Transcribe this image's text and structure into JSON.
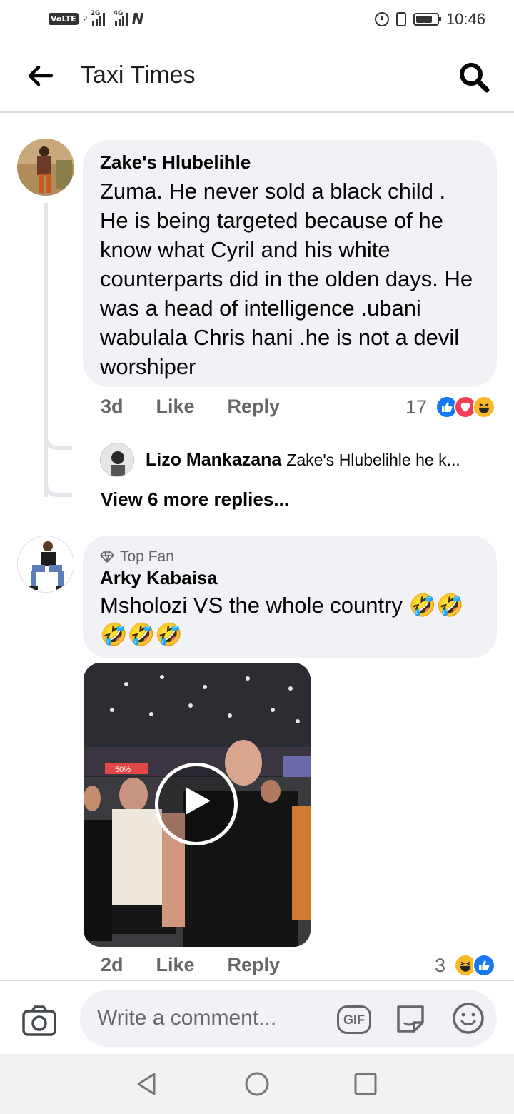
{
  "status_bar": {
    "volte": "VoLTE",
    "sim": "2",
    "net1": "2G",
    "net2": "4G",
    "time": "10:46"
  },
  "header": {
    "title": "Taxi Times"
  },
  "comments": [
    {
      "author": "Zake's Hlubelihle",
      "text": "Zuma. He never sold a black child . He is being targeted because of he know what Cyril and his white counterparts did in the olden days. He was a  head of intelligence  .ubani wabulala Chris hani .he is not a devil worshiper",
      "time": "3d",
      "like_label": "Like",
      "reply_label": "Reply",
      "reaction_count": "17",
      "reactions": [
        "like-icon",
        "love-icon",
        "haha-icon"
      ],
      "reply_preview": {
        "author": "Lizo Mankazana",
        "text": "Zake's Hlubelihle he k..."
      },
      "view_more": "View 6 more replies..."
    },
    {
      "badge": "Top Fan",
      "author": "Arky Kabaisa",
      "text_line1": "Msholozi VS the whole country",
      "emojis_line1": "🤣🤣",
      "emojis_line2": "🤣🤣🤣",
      "video_sign": "50%",
      "time": "2d",
      "like_label": "Like",
      "reply_label": "Reply",
      "reaction_count": "3",
      "reactions": [
        "haha-icon",
        "like-icon"
      ]
    }
  ],
  "composer": {
    "placeholder": "Write a comment...",
    "gif_label": "GIF"
  },
  "colors": {
    "bubble": "#f0f2f5",
    "secondary_text": "#65676b",
    "like_blue": "#1877f2",
    "love_red": "#f33e58",
    "haha_yellow": "#f7b928"
  }
}
